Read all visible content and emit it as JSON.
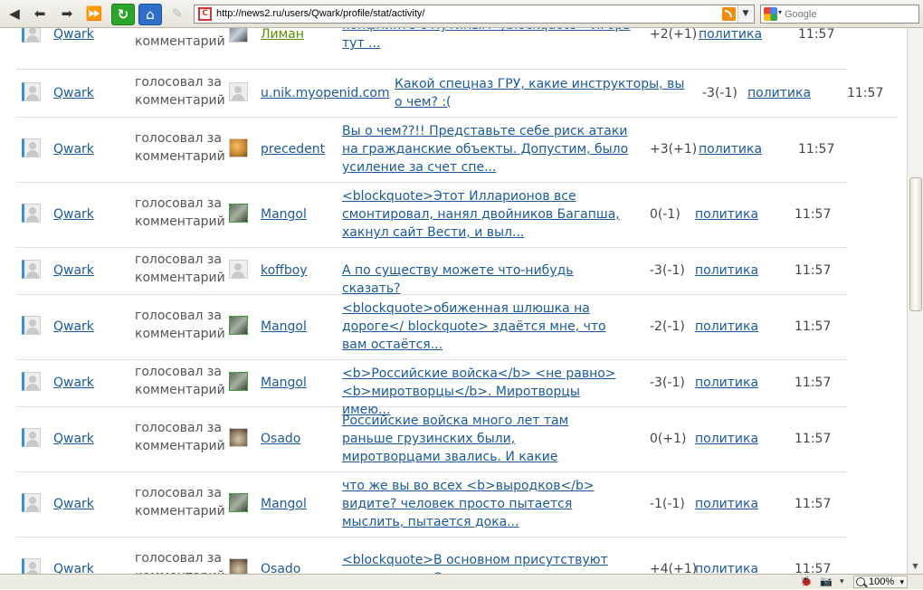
{
  "browser": {
    "url": "http://news2.ru/users/Qwark/profile/stat/activity/",
    "search_placeholder": "Google",
    "zoom": "100%"
  },
  "rows": [
    {
      "user": "Qwark",
      "action": "голосовал за комментарий",
      "target": "Лиман",
      "target_type": "liman",
      "comment": "конфликте с Путиным</blockquote> Игорь тут ...",
      "score": "+2(+1)",
      "category": "политика",
      "time": "11:57"
    },
    {
      "user": "Qwark",
      "action": "голосовал за комментарий",
      "target": "u.nik.myopenid.com",
      "target_type": "default",
      "comment": "Какой спецназ ГРУ, какие инструкторы, вы о чем? :(",
      "score": "-3(-1)",
      "category": "политика",
      "time": "11:57"
    },
    {
      "user": "Qwark",
      "action": "голосовал за комментарий",
      "target": "precedent",
      "target_type": "precedent",
      "comment": "Вы о чем??!! Представьте себе риск атаки на гражданские объекты. Допустим, было усиление за счет спе...",
      "score": "+3(+1)",
      "category": "политика",
      "time": "11:57"
    },
    {
      "user": "Qwark",
      "action": "голосовал за комментарий",
      "target": "Mangol",
      "target_type": "mangol",
      "comment": "<blockquote>Этот Илларионов все смонтировал, нанял двойников Багапша, хакнул сайт Вести, и выл...",
      "score": "0(-1)",
      "category": "политика",
      "time": "11:57"
    },
    {
      "user": "Qwark",
      "action": "голосовал за комментарий",
      "target": "koffboy",
      "target_type": "default",
      "comment": "А по существу можете что-нибудь сказать?",
      "score": "-3(-1)",
      "category": "политика",
      "time": "11:57"
    },
    {
      "user": "Qwark",
      "action": "голосовал за комментарий",
      "target": "Mangol",
      "target_type": "mangol",
      "comment": "<blockquote>обиженная шлюшка на дороге</ blockquote> здаётся мне, что вам остаётся...",
      "score": "-2(-1)",
      "category": "политика",
      "time": "11:57"
    },
    {
      "user": "Qwark",
      "action": "голосовал за комментарий",
      "target": "Mangol",
      "target_type": "mangol",
      "comment": "<b>Российские войска</b> <не равно> <b>миротворцы</b>. Миротворцы имею...",
      "score": "-3(-1)",
      "category": "политика",
      "time": "11:57"
    },
    {
      "user": "Qwark",
      "action": "голосовал за комментарий",
      "target": "Osado",
      "target_type": "osado",
      "comment": "Российские войска много лет там раньше грузинских были, миротворцами звались. И какие войска?...",
      "score": "0(+1)",
      "category": "политика",
      "time": "11:57"
    },
    {
      "user": "Qwark",
      "action": "голосовал за комментарий",
      "target": "Mangol",
      "target_type": "mangol",
      "comment": "что же вы во всех <b>выродков</b> видите? человек просто пытается мыслить, пытается дока...",
      "score": "-1(-1)",
      "category": "политика",
      "time": "11:57"
    },
    {
      "user": "Qwark",
      "action": "голосовал за комментарий",
      "target": "Osado",
      "target_type": "osado",
      "comment": "<blockquote>В основном присутствуют две позиции. Это т.н. прогрузинская позиция, в",
      "score": "+4(+1)",
      "category": "политика",
      "time": "11:57"
    }
  ]
}
